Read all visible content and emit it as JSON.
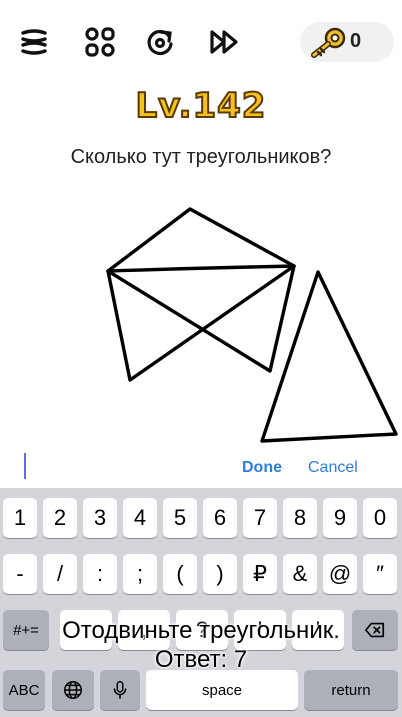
{
  "toolbar": {
    "menu_icon": "menu-icon",
    "levels_icon": "grid-icon",
    "restart_icon": "restart-icon",
    "skip_icon": "skip-icon",
    "keys_icon": "key-icon",
    "keys_count": "0"
  },
  "level": {
    "label": "Lv.142",
    "question": "Сколько тут треугольников?"
  },
  "answer_bar": {
    "input_value": "",
    "done_label": "Done",
    "cancel_label": "Cancel"
  },
  "keyboard": {
    "row1": [
      "1",
      "2",
      "3",
      "4",
      "5",
      "6",
      "7",
      "8",
      "9",
      "0"
    ],
    "row2": [
      "-",
      "/",
      ":",
      ";",
      "(",
      ")",
      "₽",
      "&",
      "@",
      "″"
    ],
    "row3_left": "#+=",
    "row3": [
      ".",
      ",",
      "?",
      "!",
      "'"
    ],
    "abc_label": "ABC",
    "space_label": "space",
    "return_label": "return"
  },
  "hint": {
    "line1": "Отодвиньте треугольник.",
    "line2": "Ответ: 7"
  },
  "colors": {
    "level_fill": "#f7c11b",
    "level_stroke": "#5a3a08",
    "key_gold": "#f2c12e",
    "link_blue": "#2f7ed8",
    "keyboard_bg": "#d3d5db"
  }
}
